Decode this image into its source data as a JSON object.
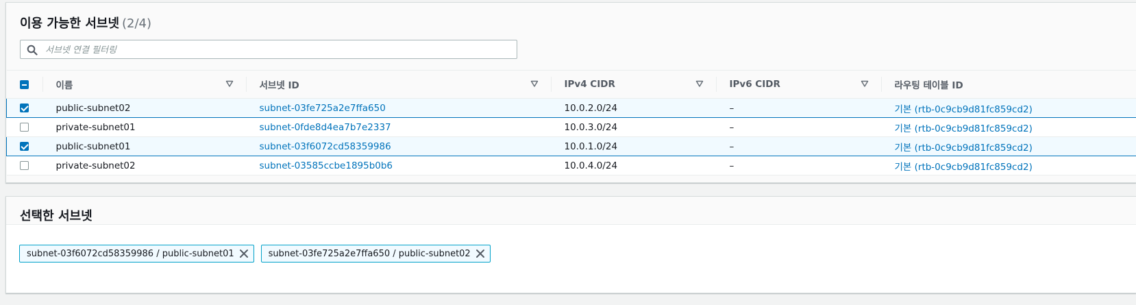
{
  "available": {
    "title": "이용 가능한 서브넷",
    "count": "(2/4)",
    "search_placeholder": "서브넷 연결 필터링",
    "columns": [
      "이름",
      "서브넷 ID",
      "IPv4 CIDR",
      "IPv6 CIDR",
      "라우팅 테이블 ID"
    ],
    "rows": [
      {
        "name": "public-subnet02",
        "subnet_id": "subnet-03fe725a2e7ffa650",
        "ipv4": "10.0.2.0/24",
        "ipv6": "–",
        "route": "기본 (rtb-0c9cb9d81fc859cd2)",
        "checked": true
      },
      {
        "name": "private-subnet01",
        "subnet_id": "subnet-0fde8d4ea7b7e2337",
        "ipv4": "10.0.3.0/24",
        "ipv6": "–",
        "route": "기본 (rtb-0c9cb9d81fc859cd2)",
        "checked": false
      },
      {
        "name": "public-subnet01",
        "subnet_id": "subnet-03f6072cd58359986",
        "ipv4": "10.0.1.0/24",
        "ipv6": "–",
        "route": "기본 (rtb-0c9cb9d81fc859cd2)",
        "checked": true
      },
      {
        "name": "private-subnet02",
        "subnet_id": "subnet-03585ccbe1895b0b6",
        "ipv4": "10.0.4.0/24",
        "ipv6": "–",
        "route": "기본 (rtb-0c9cb9d81fc859cd2)",
        "checked": false
      }
    ]
  },
  "selected": {
    "title": "선택한 서브넷",
    "tokens": [
      "subnet-03f6072cd58359986 / public-subnet01",
      "subnet-03fe725a2e7ffa650 / public-subnet02"
    ]
  },
  "colors": {
    "accent": "#0073bb",
    "selected_row_bg": "#f1faff",
    "token_border": "#00a1c9"
  },
  "icons": {
    "search": "search-icon",
    "sort": "sort-caret-down-icon",
    "remove": "close-icon"
  }
}
